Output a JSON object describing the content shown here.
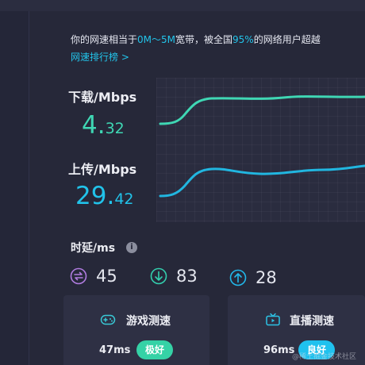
{
  "summary": {
    "prefix": "你的网速相当于",
    "bandwidth": "0M～5M",
    "middle": "宽带，被全国",
    "percent": "95%",
    "suffix": "的网络用户超越",
    "rank_link": "网速排行榜 >"
  },
  "download": {
    "label": "下载/Mbps",
    "int": "4.",
    "dec": "32"
  },
  "upload": {
    "label": "上传/Mbps",
    "int": "29.",
    "dec": "42"
  },
  "latency": {
    "label": "时延/ms",
    "info_glyph": "i",
    "items": [
      {
        "icon": "swap-arrows-icon",
        "value": "45"
      },
      {
        "icon": "download-arrow-icon",
        "value": "83"
      },
      {
        "icon": "upload-arrow-icon",
        "value": "28"
      }
    ]
  },
  "cards": {
    "game": {
      "title": "游戏测速",
      "ms": "47ms",
      "badge": "极好"
    },
    "live": {
      "title": "直播测速",
      "ms": "96ms",
      "badge": "良好"
    }
  },
  "watermark": "@稀土掘金技术社区",
  "colors": {
    "background": "#242638",
    "download_green": "#3fd7b4",
    "upload_blue": "#21c3ea",
    "latency_purple": "#b07ce0",
    "latency_teal": "#33cfae",
    "latency_blue": "#22b8ea",
    "badge_green": "#35d2a6",
    "badge_blue": "#20c1ee"
  }
}
